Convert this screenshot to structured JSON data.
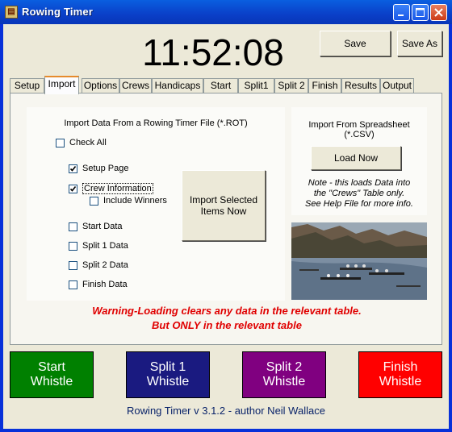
{
  "window": {
    "title": "Rowing Timer"
  },
  "clock": {
    "time": "11:52:08"
  },
  "toolbar": {
    "save_label": "Save",
    "save_as_label": "Save As"
  },
  "tabs": [
    {
      "label": "Setup"
    },
    {
      "label": "Import"
    },
    {
      "label": "Options"
    },
    {
      "label": "Crews"
    },
    {
      "label": "Handicaps"
    },
    {
      "label": "Start"
    },
    {
      "label": "Split1"
    },
    {
      "label": "Split 2"
    },
    {
      "label": "Finish"
    },
    {
      "label": "Results"
    },
    {
      "label": "Output"
    }
  ],
  "import_rot": {
    "heading": "Import Data From a Rowing Timer File (*.ROT)",
    "check_all": "Check All",
    "setup_page": "Setup Page",
    "crew_information": "Crew Information",
    "include_winners": "Include Winners",
    "start_data": "Start Data",
    "split1_data": "Split 1 Data",
    "split2_data": "Split 2 Data",
    "finish_data": "Finish Data",
    "import_button_line1": "Import Selected",
    "import_button_line2": "Items Now"
  },
  "import_csv": {
    "heading_line1": "Import From Spreadsheet",
    "heading_line2": "(*.CSV)",
    "load_button": "Load Now",
    "note_line1": "Note - this loads Data into",
    "note_line2": "the \"Crews\" Table only.",
    "note_line3": "See Help File for more info."
  },
  "warning": {
    "line1": "Warning-Loading clears any data in the relevant table.",
    "line2": "But ONLY in the relevant table"
  },
  "whistles": {
    "start": {
      "line1": "Start",
      "line2": "Whistle",
      "color": "#008000"
    },
    "split1": {
      "line1": "Split 1",
      "line2": "Whistle",
      "color": "#1a1a80"
    },
    "split2": {
      "line1": "Split 2",
      "line2": "Whistle",
      "color": "#800080"
    },
    "finish": {
      "line1": "Finish",
      "line2": "Whistle",
      "color": "#ff0000"
    }
  },
  "footer": {
    "text": "Rowing Timer v 3.1.2 - author Neil Wallace"
  }
}
